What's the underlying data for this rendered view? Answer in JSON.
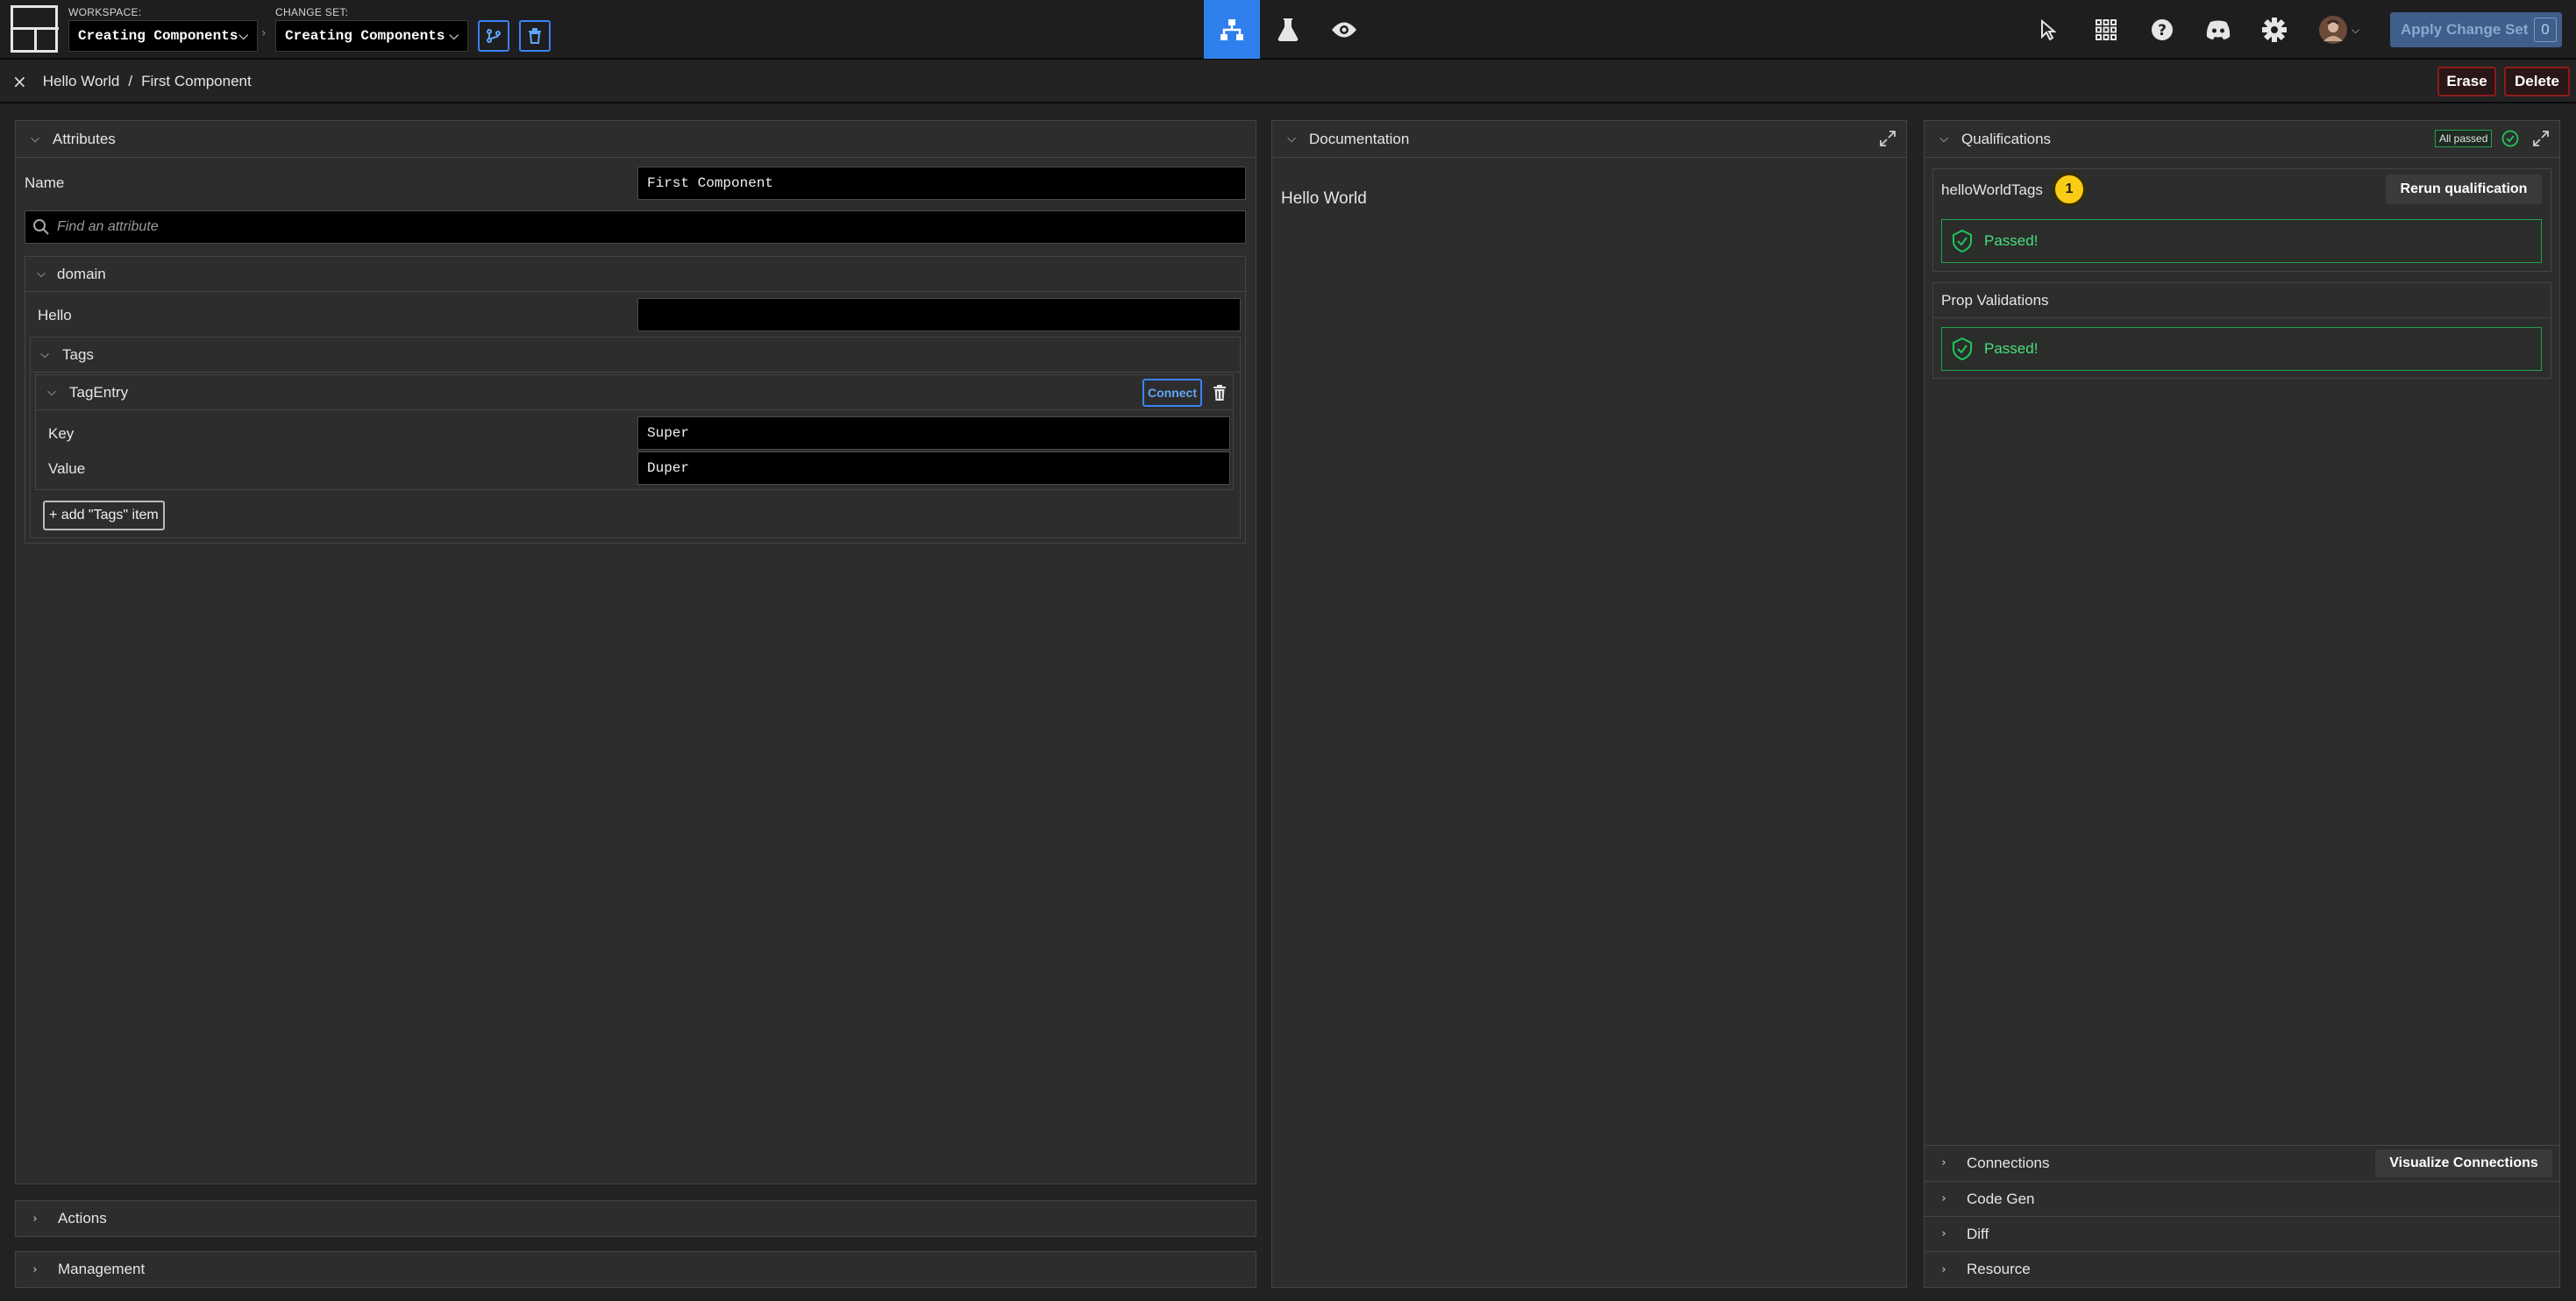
{
  "topbar": {
    "workspace_label": "WORKSPACE:",
    "workspace_value": "Creating Components",
    "changeset_label": "CHANGE SET:",
    "changeset_value": "Creating Components",
    "apply_label": "Apply Change Set",
    "apply_count": "0"
  },
  "breadcrumb": {
    "parent": "Hello World",
    "separator": "/",
    "current": "First Component",
    "erase_label": "Erase",
    "delete_label": "Delete"
  },
  "attributes": {
    "title": "Attributes",
    "name_label": "Name",
    "name_value": "First Component",
    "search_placeholder": "Find an attribute",
    "domain_label": "domain",
    "hello_label": "Hello",
    "hello_value": "",
    "tags_label": "Tags",
    "tagentry_label": "TagEntry",
    "connect_label": "Connect",
    "key_label": "Key",
    "key_value": "Super",
    "value_label": "Value",
    "value_value": "Duper",
    "add_item_label": "+ add \"Tags\" item"
  },
  "bottom_sections": {
    "actions": "Actions",
    "management": "Management"
  },
  "documentation": {
    "title": "Documentation",
    "body": "Hello World"
  },
  "qualifications": {
    "title": "Qualifications",
    "badge": "All passed",
    "items": [
      {
        "name": "helloWorldTags",
        "count": "1",
        "rerun": "Rerun qualification",
        "status": "Passed!"
      },
      {
        "name": "Prop Validations",
        "status": "Passed!"
      }
    ]
  },
  "right_sections": {
    "connections": "Connections",
    "visualize": "Visualize Connections",
    "codegen": "Code Gen",
    "diff": "Diff",
    "resource": "Resource"
  },
  "colors": {
    "accent": "#2f80ed",
    "pass": "#22c55e",
    "danger": "#8b1c1c",
    "badge_yellow": "#facc15"
  }
}
